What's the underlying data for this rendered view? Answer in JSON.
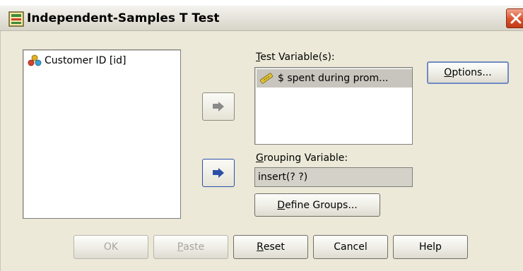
{
  "window": {
    "title": "Independent-Samples T Test",
    "icon": "spss-dialog-icon",
    "close_icon": "close-icon"
  },
  "source_list": {
    "items": [
      {
        "label": "Customer ID [id]",
        "icon": "nominal-variable-icon"
      }
    ]
  },
  "test_variables": {
    "label_mnemonic": "T",
    "label_rest": "est Variable(s):",
    "items": [
      {
        "label": "$ spent during prom...",
        "icon": "scale-variable-icon",
        "selected": true
      }
    ]
  },
  "grouping_variable": {
    "label_mnemonic": "G",
    "label_rest": "rouping Variable:",
    "value": "insert(? ?)"
  },
  "buttons": {
    "options": {
      "mnemonic": "O",
      "rest": "ptions..."
    },
    "define_groups": {
      "mnemonic": "D",
      "rest": "efine Groups..."
    },
    "ok": "OK",
    "paste": {
      "mnemonic": "P",
      "rest": "aste"
    },
    "reset": {
      "mnemonic": "R",
      "rest": "eset"
    },
    "cancel": "Cancel",
    "help": "Help"
  },
  "colors": {
    "dialog_bg": "#ece9d8",
    "selection": "#c7c5bd",
    "arrow_active": "#2b4fa7",
    "arrow_inactive": "#8a8a8a",
    "close_button": "#d9512c"
  }
}
